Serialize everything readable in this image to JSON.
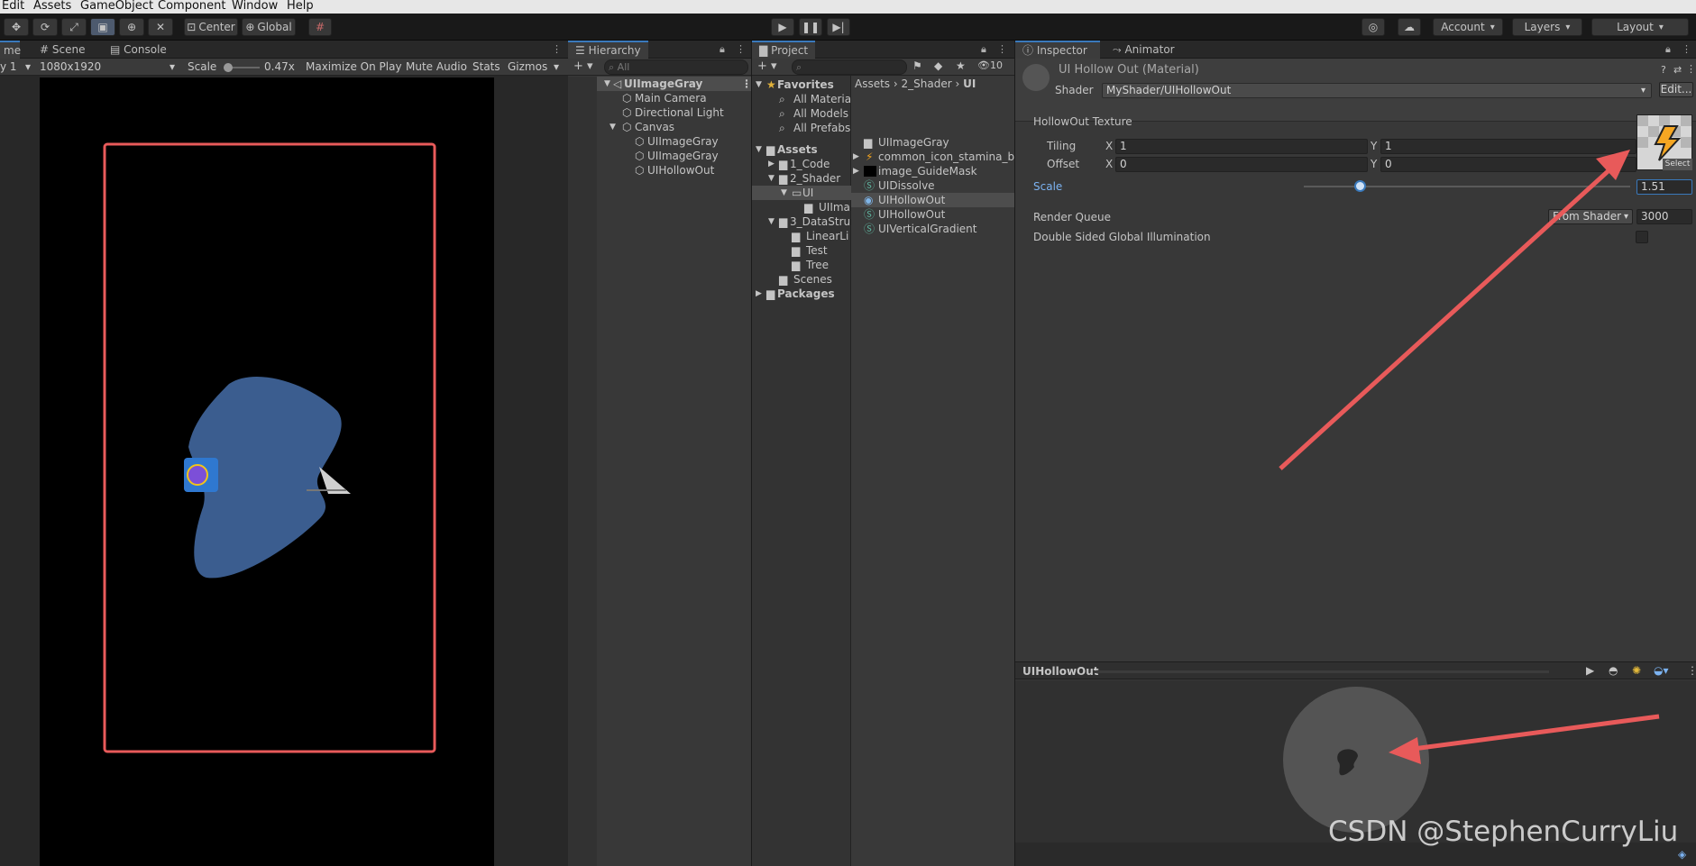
{
  "menu": [
    "Edit",
    "Assets",
    "GameObject",
    "Component",
    "Window",
    "Help"
  ],
  "toolbar": {
    "pivot_label": "Center",
    "space_label": "Global",
    "account_label": "Account",
    "layers_label": "Layers",
    "layout_label": "Layout"
  },
  "game_view": {
    "tab_partial": "me",
    "tab_scene": "Scene",
    "tab_console": "Console",
    "display_label": "y 1",
    "resolution": "1080x1920",
    "scale_label": "Scale",
    "scale_value": "0.47x",
    "maximize_label": "Maximize On Play",
    "mute_label": "Mute Audio",
    "stats_label": "Stats",
    "gizmos_label": "Gizmos"
  },
  "hierarchy": {
    "title": "Hierarchy",
    "search_placeholder": "All",
    "scene_name": "UIImageGray",
    "items": [
      "Main Camera",
      "Directional Light",
      "Canvas",
      "UIImageGray",
      "UIImageGray",
      "UIHollowOut"
    ]
  },
  "project": {
    "title": "Project",
    "search_count": "10",
    "breadcrumb": [
      "Assets",
      "2_Shader",
      "UI"
    ],
    "favorites_label": "Favorites",
    "favorites": [
      "All Materia",
      "All Models",
      "All Prefabs"
    ],
    "assets_label": "Assets",
    "tree": [
      "1_Code",
      "2_Shader",
      "UI",
      "UIIma",
      "3_DataStru",
      "LinearLi",
      "Test",
      "Tree",
      "Scenes"
    ],
    "packages_label": "Packages",
    "files": [
      "UIImageGray",
      "common_icon_stamina_big",
      "image_GuideMask",
      "UIDissolve",
      "UIHollowOut",
      "UIHollowOut",
      "UIVerticalGradient"
    ],
    "file_icons": [
      "folder-icon",
      "sprite-icon",
      "texture-icon",
      "shader-icon",
      "material-icon",
      "shader-icon",
      "shader-icon"
    ]
  },
  "inspector": {
    "tab_inspector": "Inspector",
    "tab_animator": "Animator",
    "material_title": "UI Hollow Out (Material)",
    "shader_label": "Shader",
    "shader_value": "MyShader/UIHollowOut",
    "edit_label": "Edit...",
    "texture_label": "HollowOut Texture",
    "tiling_label": "Tiling",
    "offset_label": "Offset",
    "x_label": "X",
    "y_label": "Y",
    "tiling_x": "1",
    "tiling_y": "1",
    "offset_x": "0",
    "offset_y": "0",
    "select_label": "Select",
    "scale_label": "Scale",
    "scale_value": "1.51",
    "render_queue_label": "Render Queue",
    "render_queue_mode": "From Shader",
    "render_queue_value": "3000",
    "dsgi_label": "Double Sided Global Illumination",
    "preview_title": "UIHollowOut"
  },
  "watermark": "CSDN @StephenCurryLiu",
  "colors": {
    "accent_blue": "#3a79bb",
    "selection": "#2c5d87",
    "annotation_red": "#e85a5a",
    "shape_blue": "#3b5d8f"
  }
}
